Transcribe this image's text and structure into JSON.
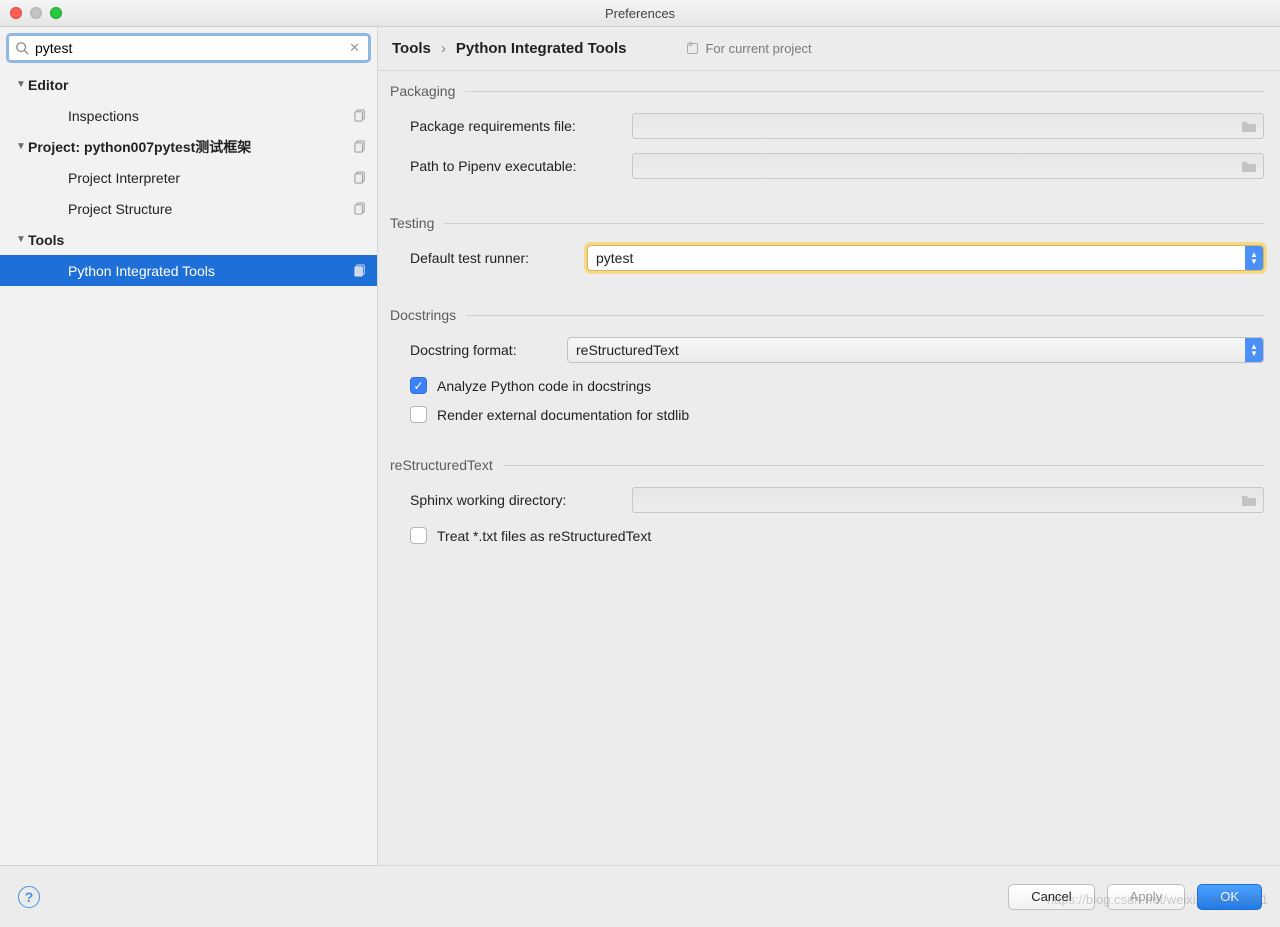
{
  "window": {
    "title": "Preferences"
  },
  "search": {
    "value": "pytest"
  },
  "sidebar": {
    "items": [
      {
        "label": "Editor",
        "depth": 0,
        "arrow": "▼",
        "copy": false,
        "selected": false
      },
      {
        "label": "Inspections",
        "depth": 1,
        "arrow": "",
        "copy": true,
        "selected": false
      },
      {
        "label": "Project: python007pytest测试框架",
        "depth": 0,
        "arrow": "▼",
        "copy": true,
        "selected": false
      },
      {
        "label": "Project Interpreter",
        "depth": 1,
        "arrow": "",
        "copy": true,
        "selected": false
      },
      {
        "label": "Project Structure",
        "depth": 1,
        "arrow": "",
        "copy": true,
        "selected": false
      },
      {
        "label": "Tools",
        "depth": 0,
        "arrow": "▼",
        "copy": false,
        "selected": false
      },
      {
        "label": "Python Integrated Tools",
        "depth": 1,
        "arrow": "",
        "copy": true,
        "selected": true
      }
    ]
  },
  "breadcrumb": {
    "part1": "Tools",
    "sep": "›",
    "part2": "Python Integrated Tools"
  },
  "scope": {
    "label": "For current project"
  },
  "sections": {
    "packaging": {
      "title": "Packaging",
      "req_label": "Package requirements file:",
      "pipenv_label": "Path to Pipenv executable:"
    },
    "testing": {
      "title": "Testing",
      "runner_label": "Default test runner:",
      "runner_value": "pytest"
    },
    "docstrings": {
      "title": "Docstrings",
      "format_label": "Docstring format:",
      "format_value": "reStructuredText",
      "analyze_label": "Analyze Python code in docstrings",
      "render_label": "Render external documentation for stdlib"
    },
    "rst": {
      "title": "reStructuredText",
      "sphinx_label": "Sphinx working directory:",
      "treat_label": "Treat *.txt files as reStructuredText"
    }
  },
  "footer": {
    "cancel": "Cancel",
    "apply": "Apply",
    "ok": "OK"
  },
  "watermark": "https://blog.csdn.net/weixin_46635091"
}
